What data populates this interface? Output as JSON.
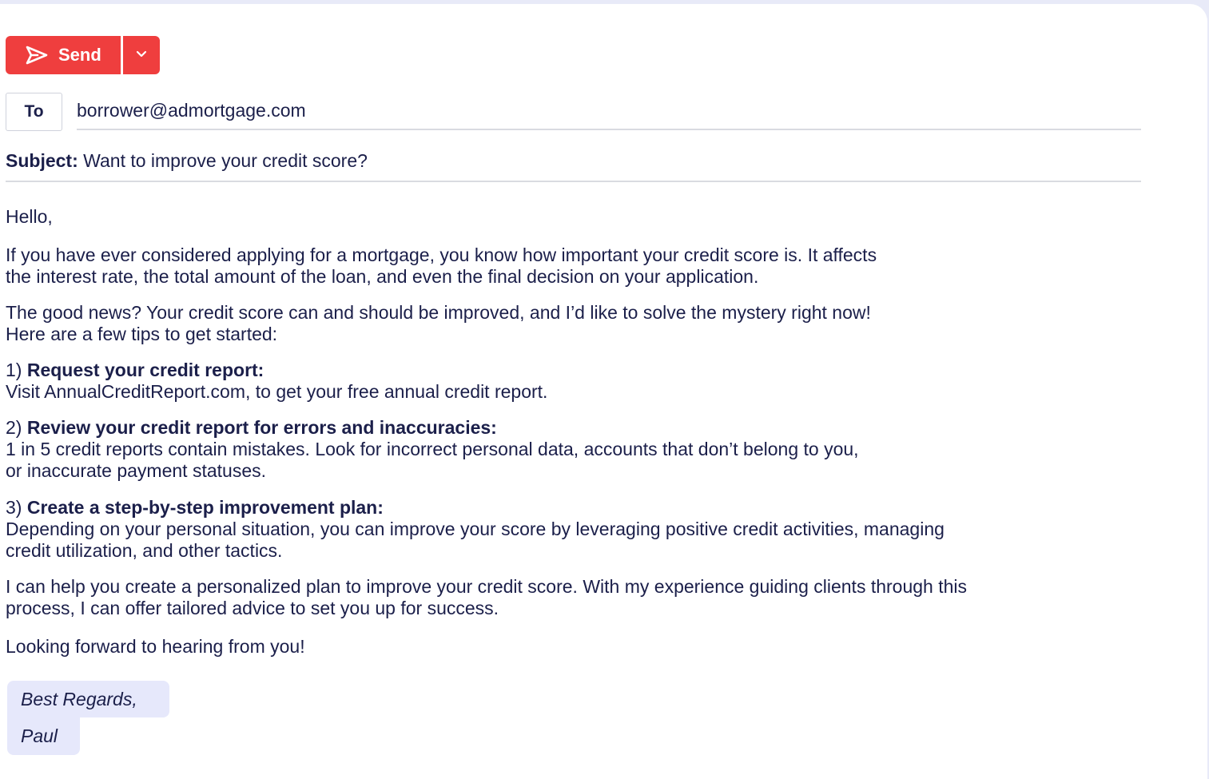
{
  "toolbar": {
    "send_label": "Send",
    "send_icon": "send-icon",
    "dropdown_icon": "chevron-down-icon",
    "accent_color": "#ef3e3e"
  },
  "recipient": {
    "to_label": "To",
    "to_value": "borrower@admortgage.com"
  },
  "subject": {
    "label": "Subject:",
    "value": "Want to improve your credit score?"
  },
  "body": {
    "greeting": "Hello,",
    "intro_line1": "If you have ever considered applying for a mortgage, you know how important your credit score is. It affects",
    "intro_line2": "the interest rate, the total amount of the loan, and even the final decision on your application.",
    "news_line1": "The good news? Your credit score can and should be improved, and I’d like to solve the mystery right now!",
    "news_line2": "Here are a few tips to get started:",
    "tips": [
      {
        "number": "1)",
        "title": "Request your credit report:",
        "lines": [
          "Visit AnnualCreditReport.com, to get your free annual credit report."
        ]
      },
      {
        "number": "2)",
        "title": "Review your credit report for errors and inaccuracies:",
        "lines": [
          "1 in 5 credit reports contain mistakes.  Look for incorrect personal data, accounts that don’t belong to you,",
          "or inaccurate payment statuses."
        ]
      },
      {
        "number": "3)",
        "title": "Create a step-by-step improvement plan:",
        "lines": [
          "Depending on your personal situation, you can improve your score by leveraging positive credit activities, managing",
          "credit utilization, and other tactics."
        ]
      }
    ],
    "offer_line1": "I can help you create a personalized plan to improve your credit score. With my experience guiding clients through this",
    "offer_line2": "process, I can offer tailored advice to set you up for success.",
    "closing": "Looking forward to hearing from you!"
  },
  "signature": {
    "line1": "Best Regards,",
    "line2": "Paul"
  }
}
